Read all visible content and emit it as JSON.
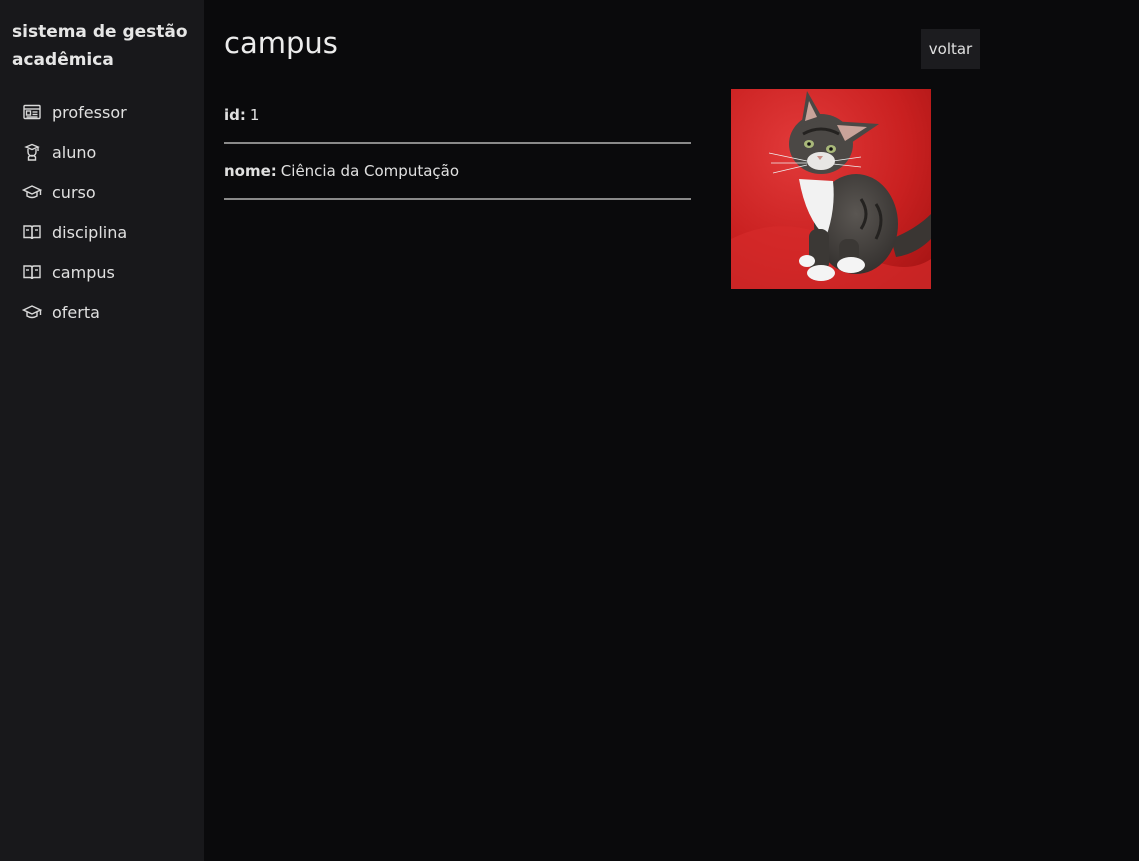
{
  "sidebar": {
    "brand": "sistema de gestão acadêmica",
    "items": [
      {
        "label": "professor",
        "icon": "id-card-icon"
      },
      {
        "label": "aluno",
        "icon": "student-icon"
      },
      {
        "label": "curso",
        "icon": "graduation-cap-icon"
      },
      {
        "label": "disciplina",
        "icon": "book-icon"
      },
      {
        "label": "campus",
        "icon": "book-icon"
      },
      {
        "label": "oferta",
        "icon": "graduation-cap-icon"
      }
    ]
  },
  "main": {
    "title": "campus",
    "back_label": "voltar",
    "fields": {
      "id_label": "id:",
      "id_value": "1",
      "nome_label": "nome:",
      "nome_value": "Ciência da Computação"
    },
    "image": {
      "subject": "kitten photo",
      "background_color": "#d42a2a"
    }
  },
  "colors": {
    "sidebar_bg": "#18181b",
    "main_bg": "#0a0a0c",
    "text": "#e6e6e6",
    "divider": "#8a8a8a",
    "button_bg": "#1c1c1f"
  }
}
